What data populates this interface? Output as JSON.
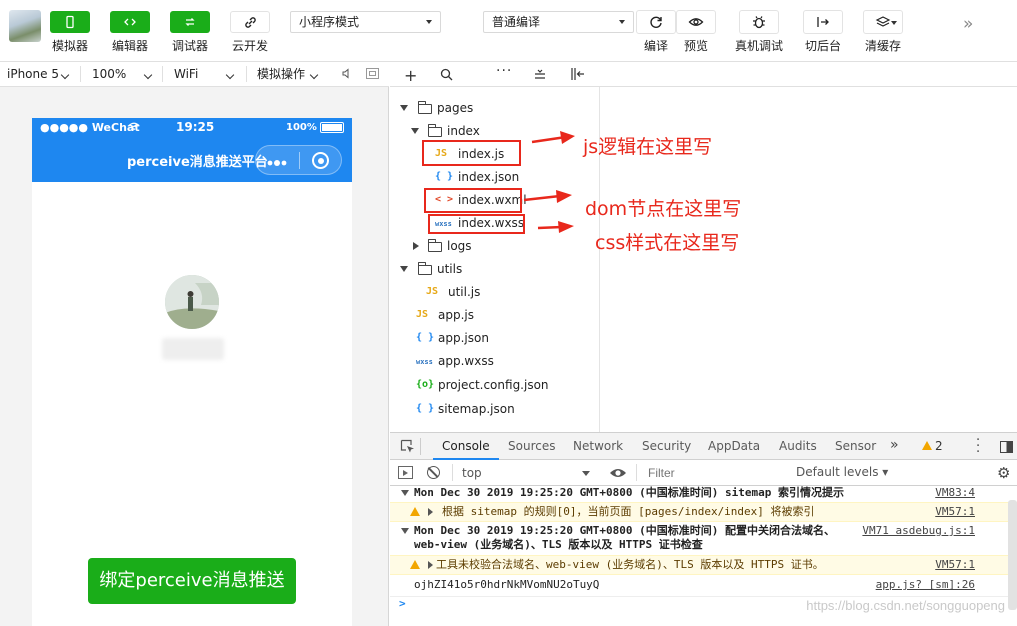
{
  "toolbar": {
    "simulator_label": "模拟器",
    "editor_label": "编辑器",
    "debugger_label": "调试器",
    "cloud_label": "云开发",
    "mode_select": "小程序模式",
    "compile_select": "普通编译",
    "compile_label": "编译",
    "preview_label": "预览",
    "remote_debug_label": "真机调试",
    "background_label": "切后台",
    "clear_cache_label": "清缓存"
  },
  "subbar": {
    "device": "iPhone 5",
    "zoom": "100%",
    "network": "WiFi",
    "simulate": "模拟操作"
  },
  "phone": {
    "carrier": "●●●●● WeChat",
    "time": "19:25",
    "battery": "100%",
    "title": "perceive消息推送平台",
    "button": "绑定perceive消息推送"
  },
  "tree": {
    "pages": "pages",
    "index": "index",
    "index_js": "index.js",
    "index_json": "index.json",
    "index_wxml": "index.wxml",
    "index_wxss": "index.wxss",
    "logs": "logs",
    "utils": "utils",
    "util_js": "util.js",
    "app_js": "app.js",
    "app_json": "app.json",
    "app_wxss": "app.wxss",
    "project_config": "project.config.json",
    "sitemap": "sitemap.json",
    "icons": {
      "js": "JS",
      "json": "{ }",
      "wxml": "< >",
      "wxss": "wxss",
      "config": "{o}"
    }
  },
  "annotations": {
    "js": "js逻辑在这里写",
    "dom": "dom节点在这里写",
    "css": "css样式在这里写",
    "color": "#e8281c"
  },
  "devtools": {
    "tabs": [
      "Console",
      "Sources",
      "Network",
      "Security",
      "AppData",
      "Audits",
      "Sensor"
    ],
    "warn_count": "2",
    "context": "top",
    "filter_placeholder": "Filter",
    "levels": "Default levels ▾"
  },
  "console": {
    "line1": "Mon Dec 30 2019 19:25:20 GMT+0800 (中国标准时间) sitemap 索引情况提示",
    "line1_src": "VM83:4",
    "line2": "根据 sitemap 的规则[0]，当前页面 [pages/index/index] 将被索引",
    "line2_src": "VM57:1",
    "line3a": "Mon Dec 30 2019 19:25:20 GMT+0800 (中国标准时间) 配置中关闭合法域名、",
    "line3b": "web-view (业务域名)、TLS 版本以及 HTTPS 证书检查",
    "line3_src": "VM71 asdebug.js:1",
    "line4": "工具未校验合法域名、web-view (业务域名)、TLS 版本以及 HTTPS 证书。",
    "line4_src": "VM57:1",
    "line5": "ojhZI41o5r0hdrNkMVomNU2oTuyQ",
    "line5_src": "app.js? [sm]:26",
    "prompt": ">"
  },
  "watermark": "https://blog.csdn.net/songguopeng",
  "colors": {
    "green": "#1aad19",
    "blue": "#1e87f0",
    "red": "#e8281c"
  }
}
